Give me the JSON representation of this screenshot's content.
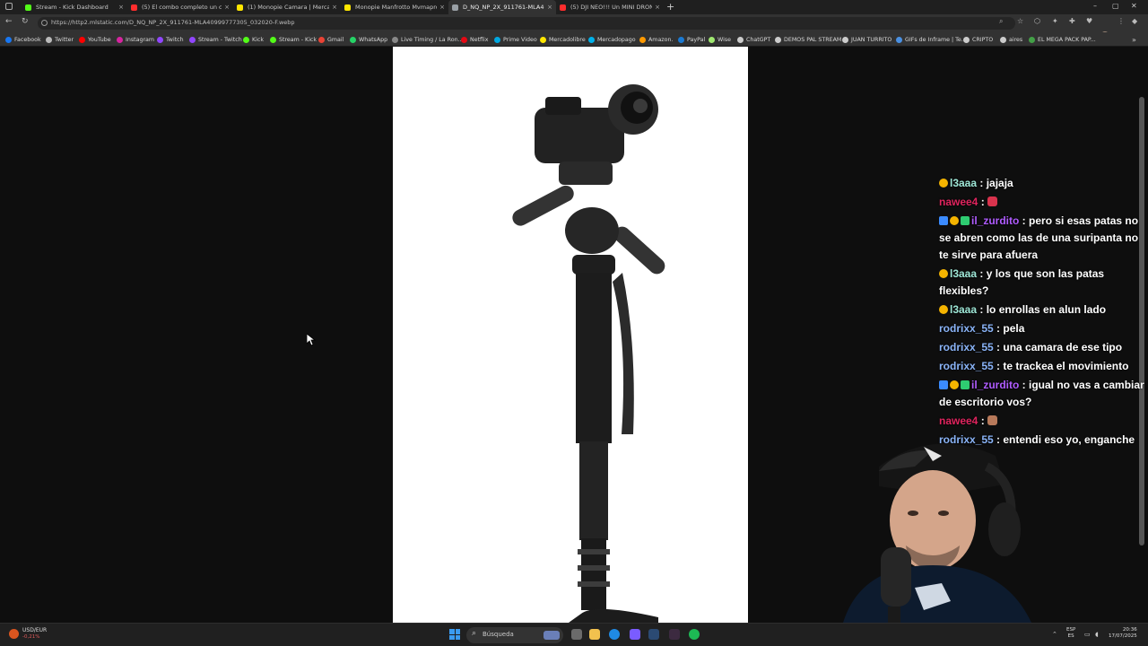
{
  "tabs": [
    {
      "label": "Stream - Kick Dashboard",
      "color": "#53fc18"
    },
    {
      "label": "(5) El combo completo un clasico",
      "color": "#ff2d2d"
    },
    {
      "label": "(1) Monopie Camara | MercadoLibre",
      "color": "#ffe600"
    },
    {
      "label": "Monopie Manfrotto Mvmapro500",
      "color": "#ffe600"
    },
    {
      "label": "D_NQ_NP_2X_911761-MLA40999",
      "color": "#9aa0a6"
    },
    {
      "label": "(5) DJI NEO!!! Un MINI DRON con",
      "color": "#ff2d2d"
    }
  ],
  "tab_close_glyph": "×",
  "new_tab_glyph": "+",
  "window_controls": {
    "minimize": "–",
    "maximize": "▢",
    "close": "✕"
  },
  "address_bar": {
    "url": "https://http2.mlstatic.com/D_NQ_NP_2X_911761-MLA40999777305_032020-F.webp"
  },
  "bookmarks": [
    {
      "label": "Facebook",
      "color": "#1877f2"
    },
    {
      "label": "Twitter",
      "color": "#bbbbbb"
    },
    {
      "label": "YouTube",
      "color": "#ff0000"
    },
    {
      "label": "Instagram",
      "color": "#d6249f"
    },
    {
      "label": "Twitch",
      "color": "#9146ff"
    },
    {
      "label": "Stream - Twitch",
      "color": "#9146ff"
    },
    {
      "label": "Kick",
      "color": "#53fc18"
    },
    {
      "label": "Stream - Kick",
      "color": "#53fc18"
    },
    {
      "label": "Gmail",
      "color": "#ea4335"
    },
    {
      "label": "WhatsApp",
      "color": "#25d366"
    },
    {
      "label": "Live Timing / La Ron...",
      "color": "#888888"
    },
    {
      "label": "Netflix",
      "color": "#e50914"
    },
    {
      "label": "Prime Video",
      "color": "#00a8e1"
    },
    {
      "label": "Mercadolibre",
      "color": "#ffe600"
    },
    {
      "label": "Mercadopago",
      "color": "#00b1ea"
    },
    {
      "label": "Amazon.",
      "color": "#ff9900"
    },
    {
      "label": "PayPal",
      "color": "#1b7ad3"
    },
    {
      "label": "Wise",
      "color": "#9fe870"
    },
    {
      "label": "ChatGPT",
      "color": "#cccccc"
    },
    {
      "label": "DEMOS PAL STREAM",
      "color": "#cccccc"
    },
    {
      "label": "JUAN TURRITO",
      "color": "#cccccc"
    },
    {
      "label": "GIFs de Inframe | Te...",
      "color": "#4a90e2"
    },
    {
      "label": "CRIPTO",
      "color": "#cccccc"
    },
    {
      "label": "aires",
      "color": "#cccccc"
    },
    {
      "label": "EL MEGA PACK PAP...",
      "color": "#43a047"
    }
  ],
  "chat": {
    "messages": [
      {
        "user": "l3aaa",
        "user_color": "#9ee6d6",
        "badges": [
          "gold"
        ],
        "text": "jajaja",
        "emote": null
      },
      {
        "user": "nawee4",
        "user_color": "#e0245e",
        "badges": [],
        "text": "",
        "emote": "red"
      },
      {
        "user": "il_zurdito",
        "user_color": "#b05cff",
        "badges": [
          "blue",
          "gold",
          "green"
        ],
        "text": "pero si esas patas no se abren como las de una suripanta no te sirve para afuera",
        "emote": null
      },
      {
        "user": "l3aaa",
        "user_color": "#9ee6d6",
        "badges": [
          "gold"
        ],
        "text": "y los que son las patas flexibles?",
        "emote": null
      },
      {
        "user": "l3aaa",
        "user_color": "#9ee6d6",
        "badges": [
          "gold"
        ],
        "text": "lo enrollas en alun lado",
        "emote": null
      },
      {
        "user": "rodrixx_55",
        "user_color": "#8ab4f8",
        "badges": [],
        "text": "pela",
        "emote": null
      },
      {
        "user": "rodrixx_55",
        "user_color": "#8ab4f8",
        "badges": [],
        "text": "una camara de ese tipo",
        "emote": null
      },
      {
        "user": "rodrixx_55",
        "user_color": "#8ab4f8",
        "badges": [],
        "text": "te trackea el movimiento",
        "emote": null
      },
      {
        "user": "il_zurdito",
        "user_color": "#b05cff",
        "badges": [
          "blue",
          "gold",
          "green"
        ],
        "text": "igual no vas a cambiar de escritorio vos?",
        "emote": null
      },
      {
        "user": "nawee4",
        "user_color": "#e0245e",
        "badges": [],
        "text": "",
        "emote": "face"
      },
      {
        "user": "rodrixx_55",
        "user_color": "#8ab4f8",
        "badges": [],
        "text": "entendi eso yo, enganche",
        "emote": null
      }
    ]
  },
  "taskbar": {
    "ticker_symbol": "USD/EUR",
    "ticker_change": "-0,21%",
    "search_label": "Búsqueda",
    "language_line1": "ESP",
    "language_line2": "ES",
    "time": "20:36",
    "date": "17/07/2025"
  }
}
